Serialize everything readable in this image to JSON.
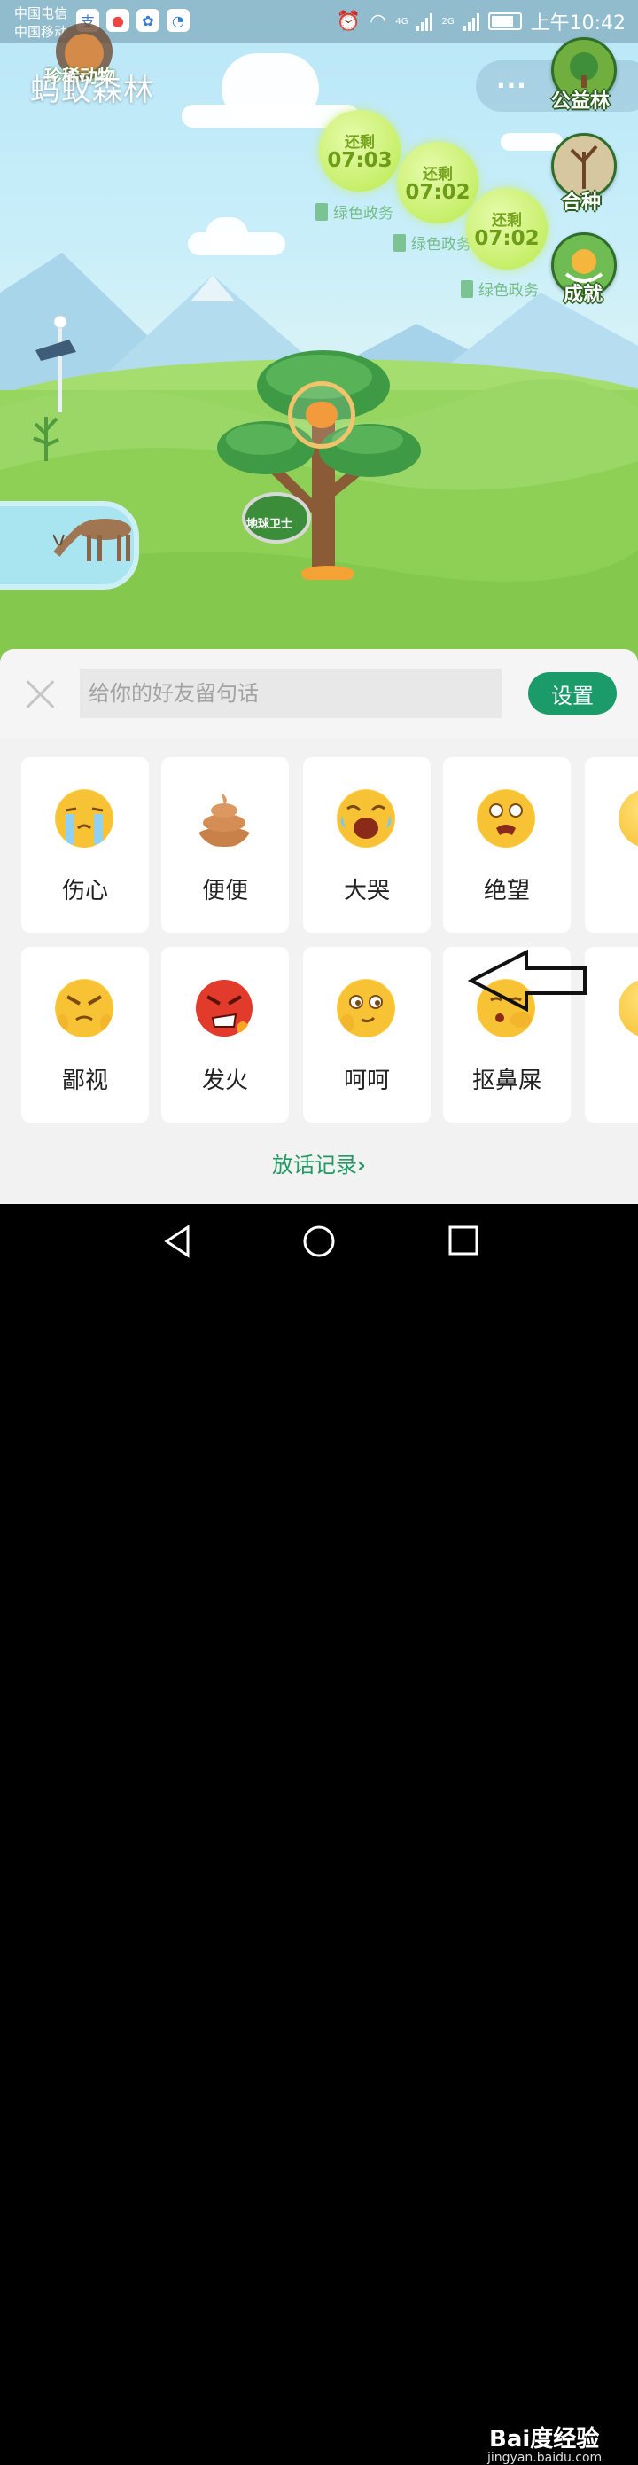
{
  "status_bar": {
    "carrier_1": "中国电信",
    "carrier_2": "中国移动",
    "network_1": "4G",
    "network_2": "2G",
    "time": "上午10:42"
  },
  "header": {
    "app_title": "蚂蚁森林",
    "animal_badge_label": "珍稀动物",
    "menu_label": "···"
  },
  "side_buttons": [
    {
      "label": "公益林",
      "icon": "public-forest-icon"
    },
    {
      "label": "合种",
      "icon": "co-plant-icon"
    },
    {
      "label": "成就",
      "icon": "achievement-icon"
    }
  ],
  "energy_bubbles": [
    {
      "status": "还剩",
      "time": "07:03",
      "tag": "绿色政务"
    },
    {
      "status": "还剩",
      "time": "07:02",
      "tag": "绿色政务"
    },
    {
      "status": "还剩",
      "time": "07:02",
      "tag": "绿色政务"
    }
  ],
  "tree": {
    "medal_label": "地球卫士"
  },
  "message_panel": {
    "input_placeholder": "给你的好友留句话",
    "input_value": "",
    "settings_label": "设置",
    "emojis": [
      {
        "label": "伤心",
        "icon": "sad-crying-emoji"
      },
      {
        "label": "便便",
        "icon": "poop-emoji"
      },
      {
        "label": "大哭",
        "icon": "loud-crying-emoji"
      },
      {
        "label": "绝望",
        "icon": "despair-emoji"
      },
      {
        "label": "鄙视",
        "icon": "contempt-emoji"
      },
      {
        "label": "发火",
        "icon": "angry-emoji"
      },
      {
        "label": "呵呵",
        "icon": "smirk-emoji"
      },
      {
        "label": "抠鼻屎",
        "icon": "nose-pick-emoji"
      }
    ],
    "history_link": "放话记录"
  },
  "watermark": {
    "brand": "Bai度经验",
    "url": "jingyan.baidu.com"
  },
  "colors": {
    "accent_green": "#1b9a6a",
    "link_green": "#1f9a63",
    "bubble_green": "#c7ef6a"
  }
}
